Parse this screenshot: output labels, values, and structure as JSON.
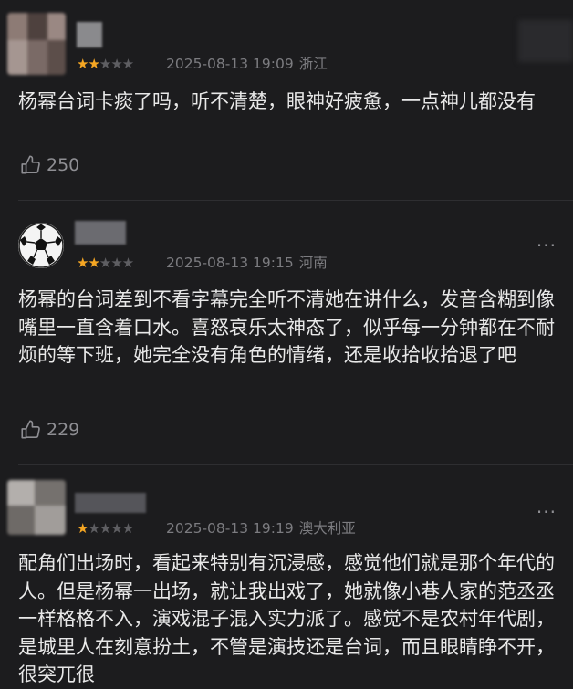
{
  "reviews": [
    {
      "rating": 2,
      "date": "2025-08-13 19:09",
      "region": "浙江",
      "text": "杨幂台词卡痰了吗，听不清楚，眼神好疲惫，一点神儿都没有",
      "likes": "250",
      "star_color": "#f5a623"
    },
    {
      "rating": 2,
      "date": "2025-08-13 19:15",
      "region": "河南",
      "text": "杨幂的台词差到不看字幕完全听不清她在讲什么，发音含糊到像嘴里一直含着口水。喜怒哀乐太神态了，似乎每一分钟都在不耐烦的等下班，她完全没有角色的情绪，还是收拾收拾退了吧",
      "likes": "229",
      "more": "···"
    },
    {
      "rating": 1,
      "date": "2025-08-13 19:19",
      "region": "澳大利亚",
      "text": "配角们出场时，看起来特别有沉浸感，感觉他们就是那个年代的人。但是杨幂一出场，就让我出戏了，她就像小巷人家的范丞丞一样格格不入，演戏混子混入实力派了。感觉不是农村年代剧，是城里人在刻意扮土，不管是演技还是台词，而且眼睛睁不开，很突兀很",
      "more": "···"
    }
  ]
}
